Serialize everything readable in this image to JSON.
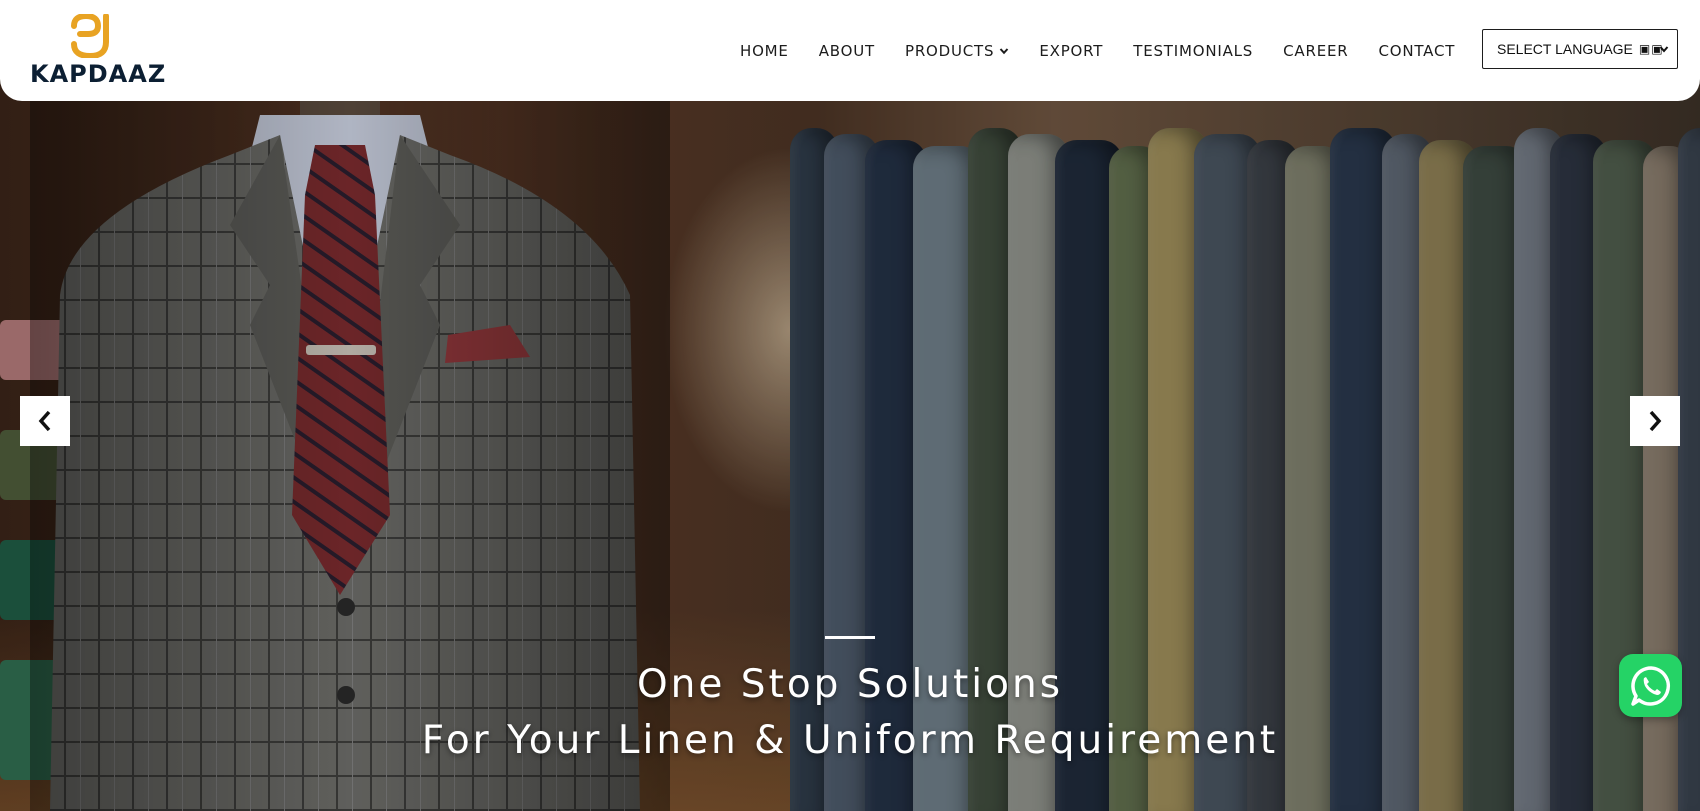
{
  "brand": {
    "name": "KAPDAAZ",
    "logo_color_primary": "#e8a323",
    "logo_color_text": "#0c1f33"
  },
  "nav": {
    "items": [
      {
        "label": "HOME"
      },
      {
        "label": "ABOUT"
      },
      {
        "label": "PRODUCTS",
        "has_dropdown": true,
        "icon": "chevron-down-icon"
      },
      {
        "label": "EXPORT"
      },
      {
        "label": "TESTIMONIALS"
      },
      {
        "label": "CAREER"
      },
      {
        "label": "CONTACT"
      }
    ]
  },
  "language_select": {
    "selected": "SELECT LANGUAGE",
    "icon": "google-translate-icon"
  },
  "hero": {
    "caption_line1": "One Stop Solutions",
    "caption_line2": "For Your Linen & Uniform Requirement",
    "prev_icon": "chevron-left-icon",
    "next_icon": "chevron-right-icon"
  },
  "whatsapp": {
    "icon": "whatsapp-icon",
    "color": "#25d366"
  }
}
